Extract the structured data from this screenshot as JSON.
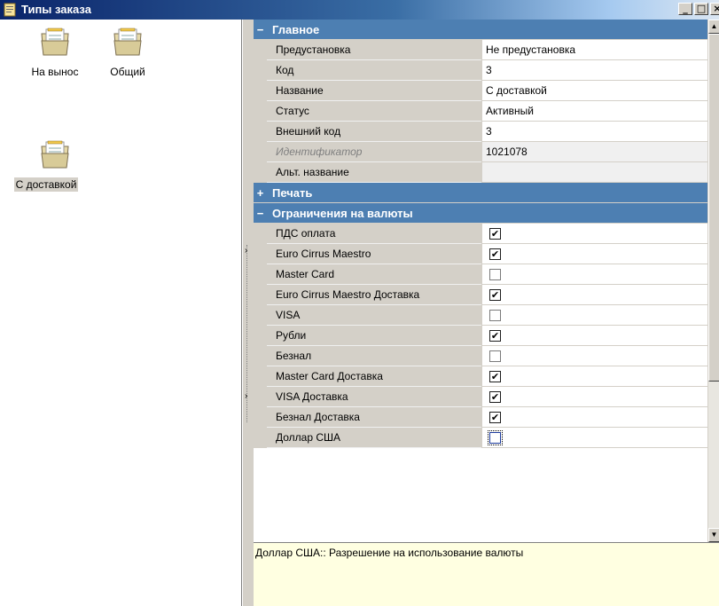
{
  "window": {
    "title": "Типы заказа",
    "icon": "order-types-icon",
    "buttons": {
      "minimize": "_",
      "maximize": "□",
      "close": "×"
    }
  },
  "tiles": [
    {
      "label": "На вынос",
      "icon": "folder-icon",
      "selected": false
    },
    {
      "label": "Общий",
      "icon": "folder-icon",
      "selected": false
    },
    {
      "label": "С доставкой",
      "icon": "folder-icon",
      "selected": true
    }
  ],
  "splitter": {
    "arrow_top": "›",
    "arrow_bottom": "›"
  },
  "grid": {
    "main": {
      "sign": "−",
      "label": "Главное",
      "rows": [
        {
          "name": "Предустановка",
          "value": "Не предустановка"
        },
        {
          "name": "Код",
          "value": "3"
        },
        {
          "name": "Название",
          "value": "С доставкой"
        },
        {
          "name": "Статус",
          "value": "Активный"
        },
        {
          "name": "Внешний код",
          "value": "3"
        },
        {
          "name": "Идентификатор",
          "value": "1021078",
          "readonly": true
        },
        {
          "name": "Альт. название",
          "value": "",
          "readonly": true
        }
      ]
    },
    "print": {
      "sign": "+",
      "label": "Печать"
    },
    "currency": {
      "sign": "−",
      "label": "Ограничения на валюты",
      "rows": [
        {
          "name": "ПДС оплата",
          "checked": true
        },
        {
          "name": "Euro Cirrus Maestro",
          "checked": true
        },
        {
          "name": "Master Card",
          "checked": false
        },
        {
          "name": "Euro Cirrus Maestro Доставка",
          "checked": true
        },
        {
          "name": "VISA",
          "checked": false
        },
        {
          "name": "Рубли",
          "checked": true
        },
        {
          "name": "Безнал",
          "checked": false
        },
        {
          "name": "Master Card Доставка",
          "checked": true
        },
        {
          "name": "VISA Доставка",
          "checked": true
        },
        {
          "name": "Безнал  Доставка",
          "checked": true
        },
        {
          "name": "Доллар США",
          "checked": false,
          "focused": true
        }
      ]
    }
  },
  "scrollbar": {
    "up": "▲",
    "down": "▼"
  },
  "description": "Доллар США:: Разрешение на использование валюты",
  "colors": {
    "category": "#4d7fb2",
    "description_bg": "#ffffe1",
    "panel": "#d4d0c8"
  }
}
